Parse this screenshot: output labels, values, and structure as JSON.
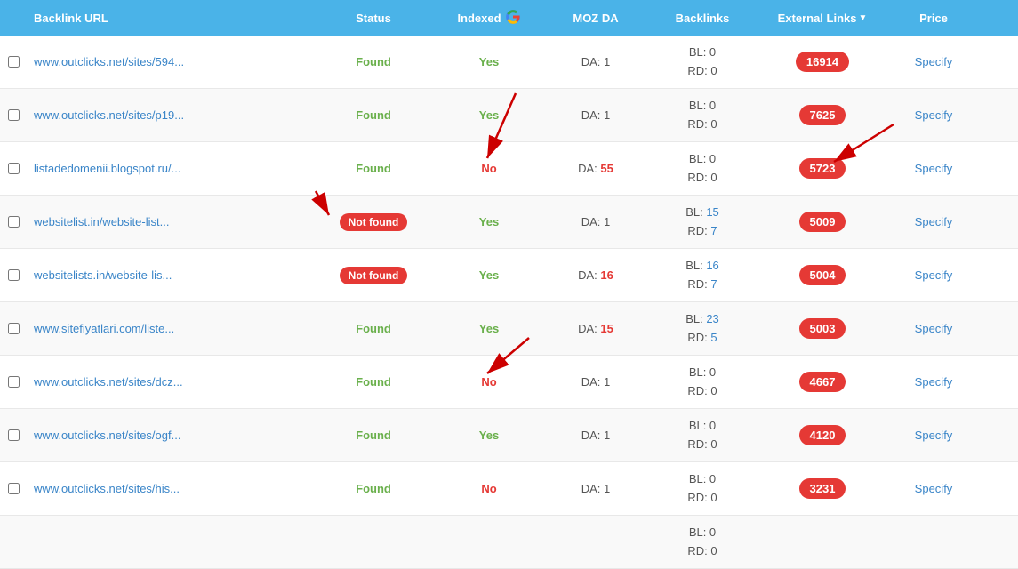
{
  "header": {
    "col_url": "Backlink URL",
    "col_status": "Status",
    "col_indexed": "Indexed",
    "col_moz": "MOZ DA",
    "col_backlinks": "Backlinks",
    "col_external": "External Links",
    "col_price": "Price"
  },
  "rows": [
    {
      "url": "www.outclicks.net/sites/594...",
      "status": "Found",
      "status_type": "found",
      "indexed": "Yes",
      "indexed_type": "yes",
      "da": "1",
      "da_highlight": false,
      "bl": "0",
      "rd": "0",
      "external": "16914",
      "price": "Specify"
    },
    {
      "url": "www.outclicks.net/sites/p19...",
      "status": "Found",
      "status_type": "found",
      "indexed": "Yes",
      "indexed_type": "yes",
      "da": "1",
      "da_highlight": false,
      "bl": "0",
      "rd": "0",
      "external": "7625",
      "price": "Specify"
    },
    {
      "url": "listadedomenii.blogspot.ru/...",
      "status": "Found",
      "status_type": "found",
      "indexed": "No",
      "indexed_type": "no",
      "da": "55",
      "da_highlight": true,
      "bl": "0",
      "rd": "0",
      "external": "5723",
      "price": "Specify"
    },
    {
      "url": "websitelist.in/website-list...",
      "status": "Not found",
      "status_type": "not-found",
      "indexed": "Yes",
      "indexed_type": "yes",
      "da": "1",
      "da_highlight": false,
      "bl": "15",
      "rd": "7",
      "external": "5009",
      "price": "Specify"
    },
    {
      "url": "websitelists.in/website-lis...",
      "status": "Not found",
      "status_type": "not-found",
      "indexed": "Yes",
      "indexed_type": "yes",
      "da": "16",
      "da_highlight": true,
      "bl": "16",
      "rd": "7",
      "external": "5004",
      "price": "Specify"
    },
    {
      "url": "www.sitefiyatlari.com/liste...",
      "status": "Found",
      "status_type": "found",
      "indexed": "Yes",
      "indexed_type": "yes",
      "da": "15",
      "da_highlight": true,
      "bl": "23",
      "rd": "5",
      "external": "5003",
      "price": "Specify"
    },
    {
      "url": "www.outclicks.net/sites/dcz...",
      "status": "Found",
      "status_type": "found",
      "indexed": "No",
      "indexed_type": "no",
      "da": "1",
      "da_highlight": false,
      "bl": "0",
      "rd": "0",
      "external": "4667",
      "price": "Specify"
    },
    {
      "url": "www.outclicks.net/sites/ogf...",
      "status": "Found",
      "status_type": "found",
      "indexed": "Yes",
      "indexed_type": "yes",
      "da": "1",
      "da_highlight": false,
      "bl": "0",
      "rd": "0",
      "external": "4120",
      "price": "Specify"
    },
    {
      "url": "www.outclicks.net/sites/his...",
      "status": "Found",
      "status_type": "found",
      "indexed": "No",
      "indexed_type": "no",
      "da": "1",
      "da_highlight": false,
      "bl": "0",
      "rd": "0",
      "external": "3231",
      "price": "Specify"
    },
    {
      "url": "",
      "status": "",
      "status_type": "",
      "indexed": "",
      "indexed_type": "",
      "da": "",
      "da_highlight": false,
      "bl": "0",
      "rd": "",
      "external": "",
      "price": ""
    }
  ],
  "colors": {
    "header_bg": "#4ab3e8",
    "found_color": "#6ab04c",
    "not_found_bg": "#e53935",
    "external_bg": "#e53935",
    "link_color": "#3a85c8"
  }
}
